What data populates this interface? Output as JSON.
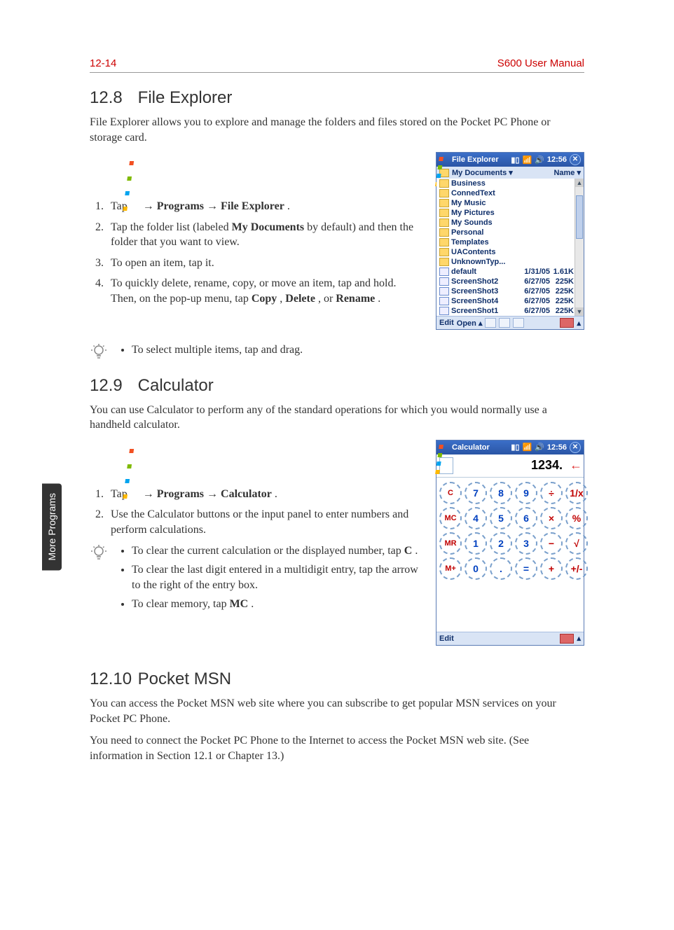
{
  "header": {
    "page_num": "12-14",
    "manual_title": "S600 User Manual"
  },
  "side_tab": "More Programs",
  "sec_fe": {
    "num": "12.8",
    "title": "File Explorer",
    "intro": "File Explorer allows you to explore and manage the folders and files stored on the Pocket PC Phone or storage card.",
    "step1_a": "Tap ",
    "step1_b": " → ",
    "step1_prog": "Programs",
    "step1_c": " → ",
    "step1_fe": "File Explorer",
    "step1_d": ".",
    "step2_a": "Tap the folder list (labeled ",
    "step2_bold": "My Documents",
    "step2_b": " by default) and then the folder that you want to view.",
    "step3": "To open an item, tap it.",
    "step4_a": "To quickly delete, rename, copy, or move an item, tap and hold. Then, on the pop-up menu, tap ",
    "step4_copy": "Copy",
    "step4_sep1": ", ",
    "step4_delete": "Delete",
    "step4_sep2": ", or ",
    "step4_rename": "Rename",
    "step4_end": ".",
    "tip": "To select multiple items, tap and drag."
  },
  "fe_shot": {
    "title": "File Explorer",
    "time": "12:56",
    "subbar_label": "My Documents",
    "sort_label": "Name",
    "folders": [
      "Business",
      "ConnedText",
      "My Music",
      "My Pictures",
      "My Sounds",
      "Personal",
      "Templates",
      "UAContents",
      "UnknownTyp..."
    ],
    "files": [
      {
        "name": "default",
        "date": "1/31/05",
        "size": "1.61K"
      },
      {
        "name": "ScreenShot2",
        "date": "6/27/05",
        "size": "225K"
      },
      {
        "name": "ScreenShot3",
        "date": "6/27/05",
        "size": "225K"
      },
      {
        "name": "ScreenShot4",
        "date": "6/27/05",
        "size": "225K"
      },
      {
        "name": "ScreenShot1",
        "date": "6/27/05",
        "size": "225K"
      }
    ],
    "bottom_edit": "Edit",
    "bottom_open": "Open"
  },
  "sec_calc": {
    "num": "12.9",
    "title": "Calculator",
    "intro": "You can use Calculator to perform any of the standard operations for which you would normally use a handheld calculator.",
    "step1_a": "Tap ",
    "step1_b": " → ",
    "step1_prog": "Programs",
    "step1_c": " → ",
    "step1_cal": "Calculator",
    "step1_d": ".",
    "step2": "Use the Calculator buttons or the input panel to enter numbers and perform calculations.",
    "tip1_a": "To clear the current calculation or the displayed number, tap ",
    "tip1_bold": "C",
    "tip1_b": ".",
    "tip2": "To clear the last digit entered in a multidigit entry, tap the arrow to the right of the entry box.",
    "tip3_a": "To clear memory, tap ",
    "tip3_bold": "MC",
    "tip3_b": "."
  },
  "calc_shot": {
    "title": "Calculator",
    "time": "12:56",
    "display": "1234.",
    "buttons": [
      [
        "C",
        "7",
        "8",
        "9",
        "÷",
        "1/x"
      ],
      [
        "MC",
        "4",
        "5",
        "6",
        "×",
        "%"
      ],
      [
        "MR",
        "1",
        "2",
        "3",
        "−",
        "√"
      ],
      [
        "M+",
        "0",
        ".",
        "=",
        "+",
        "+/-"
      ]
    ],
    "num_set": [
      "7",
      "8",
      "9",
      "4",
      "5",
      "6",
      "1",
      "2",
      "3",
      "0",
      ".",
      "="
    ],
    "bottom_edit": "Edit"
  },
  "sec_msn": {
    "num": "12.10",
    "title": "Pocket MSN",
    "p1": "You can access the Pocket MSN web site where you can subscribe to get popular MSN services on your Pocket PC Phone.",
    "p2": "You need to connect the Pocket PC Phone to the Internet to access the Pocket MSN web site. (See information in Section 12.1 or Chapter 13.)"
  }
}
